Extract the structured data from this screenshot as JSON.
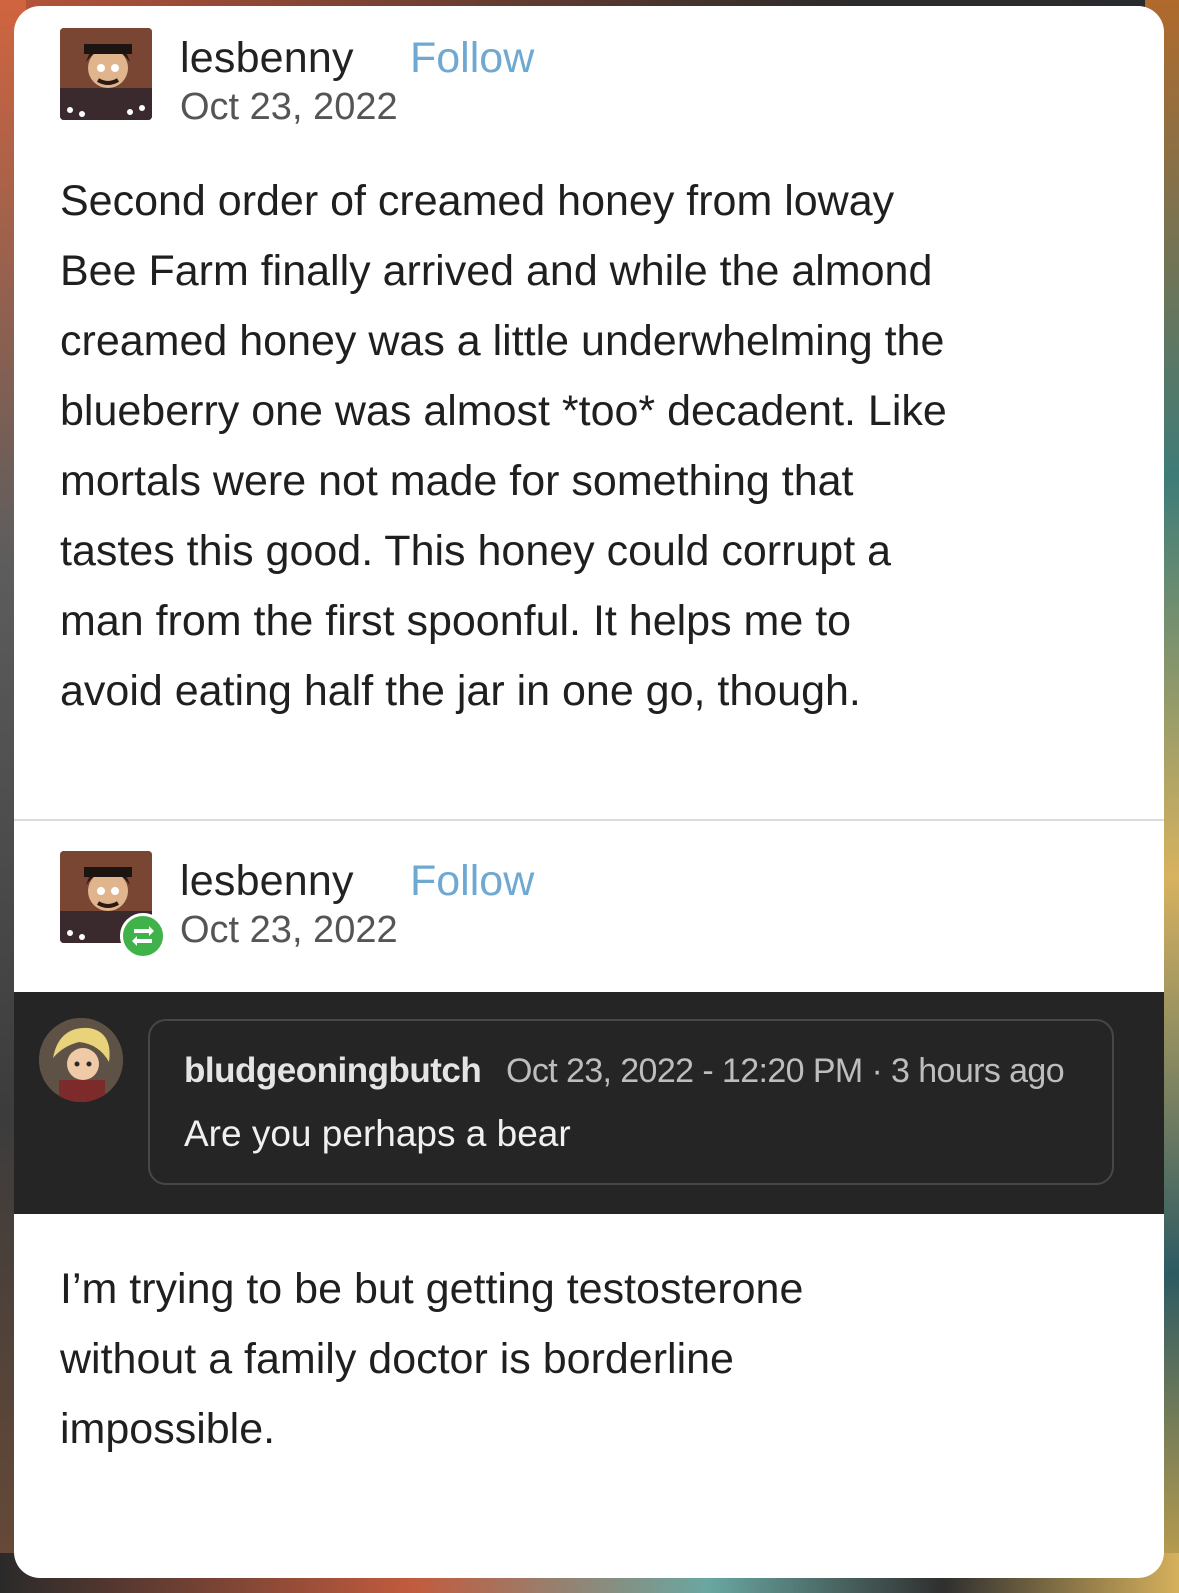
{
  "colors": {
    "card_background": "#ffffff",
    "follow_link": "#6fa9d2",
    "ask_band": "#252525",
    "reblog_badge": "#3fb24a"
  },
  "post": {
    "username": "lesbenny",
    "follow_label": "Follow",
    "date": "Oct 23, 2022",
    "avatar_icon": "user-avatar-icon",
    "body_lines": [
      "Second order of creamed honey from loway",
      "Bee Farm finally arrived and while the almond",
      "creamed honey was a little underwhelming the",
      "blueberry one was almost *too* decadent. Like",
      "mortals were not made for something that",
      "tastes this good. This honey could corrupt a",
      "man from the first spoonful. It helps me to",
      "avoid eating half the jar in one go, though."
    ]
  },
  "reblog": {
    "username": "lesbenny",
    "follow_label": "Follow",
    "date": "Oct 23, 2022",
    "badge_icon": "reblog-icon",
    "ask": {
      "asker_name": "bludgeoningbutch",
      "meta": "Oct 23, 2022 - 12:20 PM · 3 hours ago",
      "question": "Are you perhaps a bear"
    },
    "answer_lines": [
      "I’m trying to be but getting testosterone",
      "without a family doctor is borderline",
      "impossible."
    ]
  }
}
